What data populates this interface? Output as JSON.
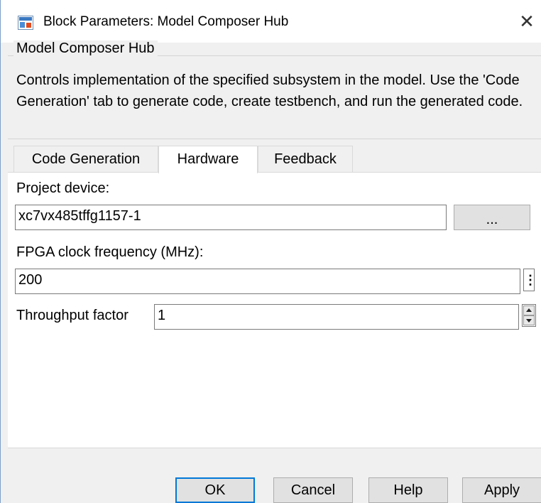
{
  "window": {
    "title": "Block Parameters: Model Composer Hub",
    "close_glyph": "✕"
  },
  "group": {
    "legend": "Model Composer Hub",
    "description": "Controls implementation of the specified subsystem in the model. Use the 'Code Generation' tab to generate code, create testbench, and run the generated code."
  },
  "tabs": [
    {
      "label": "Code Generation",
      "active": false
    },
    {
      "label": "Hardware",
      "active": true
    },
    {
      "label": "Feedback",
      "active": false
    }
  ],
  "hardware": {
    "project_device_label": "Project device:",
    "project_device_value": "xc7vx485tffg1157-1",
    "browse_label": "...",
    "fpga_clock_label": "FPGA clock frequency (MHz):",
    "fpga_clock_value": "200",
    "fpga_menu_glyph": "⋮",
    "throughput_label": "Throughput factor",
    "throughput_value": "1"
  },
  "footer": {
    "ok": "OK",
    "cancel": "Cancel",
    "help": "Help",
    "apply": "Apply"
  },
  "colors": {
    "accent": "#0078d7",
    "dialog_bg": "#f0f0f0",
    "panel_bg": "#ffffff"
  },
  "icons": {
    "app": "block-parameters-icon",
    "close": "close-icon",
    "menu": "vertical-ellipsis-icon",
    "spinner": "spinner-arrows-icon"
  }
}
